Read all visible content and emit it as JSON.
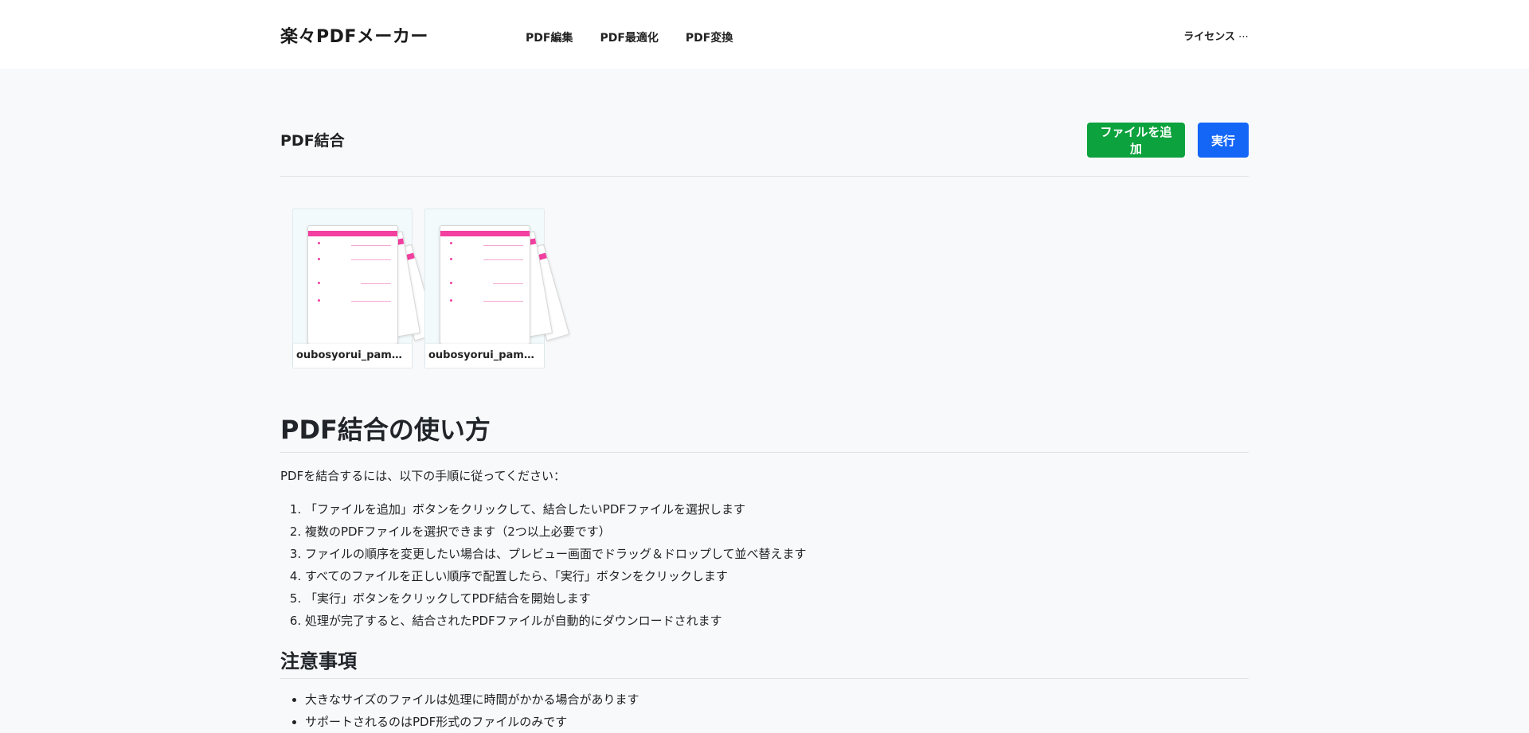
{
  "header": {
    "logo": "楽々PDFメーカー",
    "nav": [
      "PDF編集",
      "PDF最適化",
      "PDF変換"
    ],
    "license": "ライセンス"
  },
  "toolbar": {
    "title": "PDF結合",
    "add_label": "ファイルを追加",
    "run_label": "実行"
  },
  "files": [
    {
      "name": "oubosyorui_pamphl..."
    },
    {
      "name": "oubosyorui_pamphl..."
    }
  ],
  "howto": {
    "title": "PDF結合の使い方",
    "intro": "PDFを結合するには、以下の手順に従ってください：",
    "steps": [
      "「ファイルを追加」ボタンをクリックして、結合したいPDFファイルを選択します",
      "複数のPDFファイルを選択できます（2つ以上必要です）",
      "ファイルの順序を変更したい場合は、プレビュー画面でドラッグ＆ドロップして並べ替えます",
      "すべてのファイルを正しい順序で配置したら、「実行」ボタンをクリックします",
      "「実行」ボタンをクリックしてPDF結合を開始します",
      "処理が完了すると、結合されたPDFファイルが自動的にダウンロードされます"
    ]
  },
  "notes": {
    "title": "注意事項",
    "items": [
      "大きなサイズのファイルは処理に時間がかかる場合があります",
      "サポートされるのはPDF形式のファイルのみです"
    ]
  },
  "colors": {
    "add_button": "#0ca23d",
    "run_button": "#1466f7",
    "thumbnail_accent": "#f33fa0"
  }
}
